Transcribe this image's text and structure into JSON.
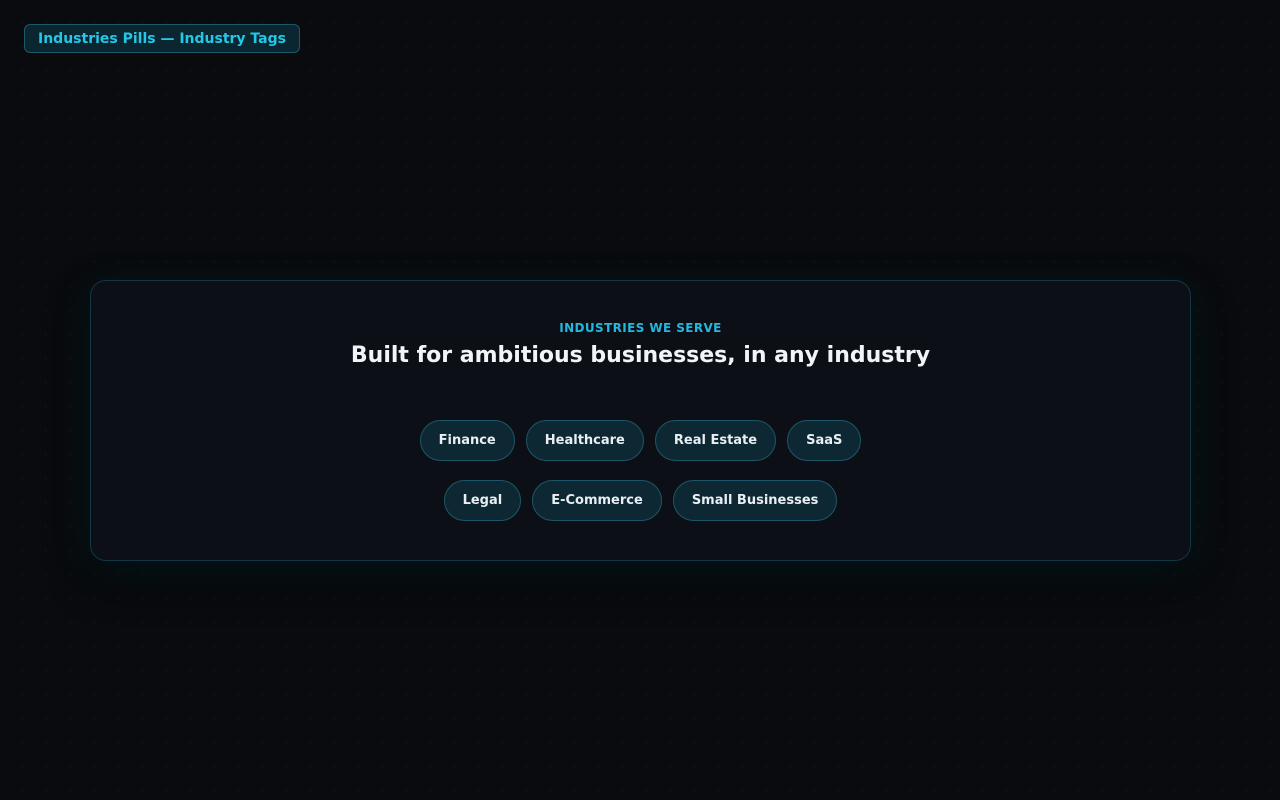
{
  "badge": {
    "label": "Industries Pills — Industry Tags"
  },
  "section": {
    "eyebrow": "INDUSTRIES WE SERVE",
    "headline": "Built for ambitious businesses, in any industry"
  },
  "industries": {
    "row1": [
      "Finance",
      "Healthcare",
      "Real Estate",
      "SaaS"
    ],
    "row2": [
      "Legal",
      "E-Commerce",
      "Small Businesses"
    ]
  },
  "colors": {
    "background": "#090b0e",
    "accent": "#22c8e6",
    "card": "#0c1016",
    "pill": "#0d2733",
    "pill_border": "#1d5668"
  }
}
